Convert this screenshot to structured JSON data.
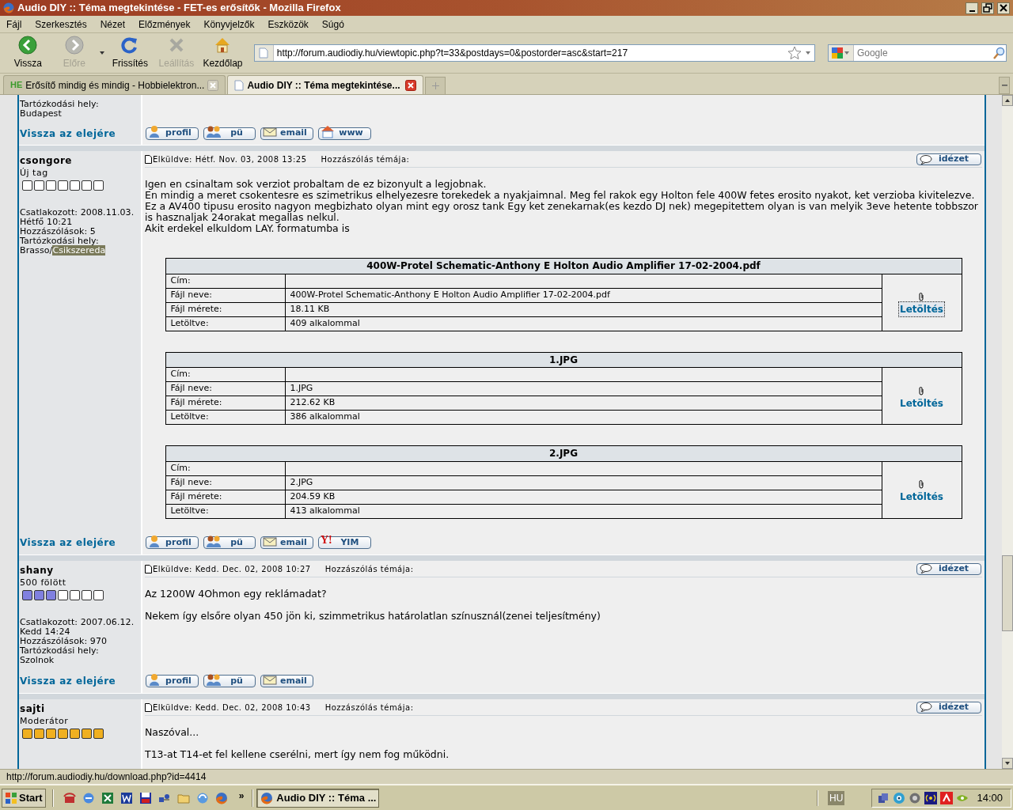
{
  "window": {
    "title": "Audio DIY :: Téma megtekintése - FET-es erősítők - Mozilla Firefox"
  },
  "menu": [
    {
      "label": "Fájl"
    },
    {
      "label": "Szerkesztés"
    },
    {
      "label": "Nézet"
    },
    {
      "label": "Előzmények"
    },
    {
      "label": "Könyvjelzők"
    },
    {
      "label": "Eszközök"
    },
    {
      "label": "Súgó"
    }
  ],
  "toolbar": {
    "buttons": [
      {
        "kind": "back",
        "label": "Vissza",
        "disabled": false
      },
      {
        "kind": "forward",
        "label": "Előre",
        "disabled": true
      },
      {
        "kind": "reload",
        "label": "Frissítés",
        "disabled": false
      },
      {
        "kind": "stop",
        "label": "Leállítás",
        "disabled": true
      },
      {
        "kind": "home",
        "label": "Kezdőlap",
        "disabled": false
      }
    ],
    "url": "http://forum.audiodiy.hu/viewtopic.php?t=33&postdays=0&postorder=asc&start=217",
    "search_placeholder": "Google"
  },
  "tabs": [
    {
      "label": "Erősítő mindig és mindig - Hobbielektron...",
      "favicon_text": "HE",
      "selected": false
    },
    {
      "label": "Audio DIY :: Téma megtekintése...",
      "selected": true
    }
  ],
  "top_post": {
    "details": [
      "Tartózkodási hely:",
      "Budapest"
    ],
    "back_link": "Vissza az elejére",
    "buttons": [
      {
        "kind": "profile",
        "label": "profil"
      },
      {
        "kind": "pm",
        "label": "pü"
      },
      {
        "kind": "email",
        "label": "email"
      },
      {
        "kind": "www",
        "label": "www"
      }
    ]
  },
  "posts": [
    {
      "author": "csongore",
      "rank_title": "Új tag",
      "rank": {
        "stars": 0
      },
      "details": [
        "Csatlakozott: 2008.11.03.",
        "Hétfő 10:21",
        "Hozzászólások: 5",
        "Tartózkodási hely:"
      ],
      "location_parts": [
        {
          "text": "Brasso/",
          "highlighted": false
        },
        {
          "text": "Csikszereda",
          "highlighted": true
        }
      ],
      "posted": "Elküldve: Hétf. Nov. 03, 2008 13:25",
      "subject_label": "Hozzászólás témája:",
      "quote_button": "idézet",
      "paragraphs": [
        [
          "Igen en csinaltam sok verziot probaltam de ez bizonyult a legjobnak.",
          "En mindig a meret csokentesre es szimetrikus elhelyezesre torekedek a nyakjaimnal. Meg fel rakok egy Holton fele 400W fetes erosito nyakot, ket verzioba kivitelezve.",
          "Ez a AV400 tipusu erosito nagyon megbizhato olyan mint egy orosz tank Egy ket zenekarnak(es kezdo DJ nek) megepitettem olyan is van melyik 3eve hetente tobbszor is hasznaljak 24orakat megallas nelkul.",
          "Akit erdekel elkuldom LAY. formatumba is"
        ]
      ],
      "attachments": [
        {
          "title": "400W-Protel Schematic-Anthony E Holton Audio Amplifier 17-02-2004.pdf",
          "rows": [
            {
              "label": "Cím:"
            },
            {
              "label": "Fájl neve:",
              "value": "400W-Protel Schematic-Anthony E Holton Audio Amplifier 17-02-2004.pdf"
            },
            {
              "label": "Fájl mérete:",
              "value": "18.11 KB"
            },
            {
              "label": "Letöltve:",
              "value": "409 alkalommal"
            }
          ],
          "download": "Letöltés",
          "focused": true
        },
        {
          "title": "1.JPG",
          "rows": [
            {
              "label": "Cím:"
            },
            {
              "label": "Fájl neve:",
              "value": "1.JPG"
            },
            {
              "label": "Fájl mérete:",
              "value": "212.62 KB"
            },
            {
              "label": "Letöltve:",
              "value": "386 alkalommal"
            }
          ],
          "download": "Letöltés",
          "focused": false
        },
        {
          "title": "2.JPG",
          "rows": [
            {
              "label": "Cím:"
            },
            {
              "label": "Fájl neve:",
              "value": "2.JPG"
            },
            {
              "label": "Fájl mérete:",
              "value": "204.59 KB"
            },
            {
              "label": "Letöltve:",
              "value": "413 alkalommal"
            }
          ],
          "download": "Letöltés",
          "focused": false
        }
      ],
      "back_link": "Vissza az elejére",
      "buttons": [
        {
          "kind": "profile",
          "label": "profil"
        },
        {
          "kind": "pm",
          "label": "pü"
        },
        {
          "kind": "email",
          "label": "email"
        },
        {
          "kind": "yim",
          "label": "YIM",
          "logo": "Y!"
        }
      ]
    },
    {
      "author": "shany",
      "rank_title": "500 fölött",
      "rank": {
        "stars": 3,
        "color": "#8080e0"
      },
      "details": [
        "Csatlakozott: 2007.06.12.",
        "Kedd 14:24",
        "Hozzászólások: 970",
        "Tartózkodási hely:"
      ],
      "location_parts": [
        {
          "text": "Szolnok",
          "highlighted": false
        }
      ],
      "posted": "Elküldve: Kedd. Dec. 02, 2008 10:27",
      "subject_label": "Hozzászólás témája:",
      "quote_button": "idézet",
      "paragraphs": [
        [
          "Az 1200W 4Ohmon egy reklámadat?"
        ],
        [
          "Nekem így elsőre olyan 450 jön ki, szimmetrikus határolatlan színusznál(zenei teljesítmény)"
        ]
      ],
      "back_link": "Vissza az elejére",
      "buttons": [
        {
          "kind": "profile",
          "label": "profil"
        },
        {
          "kind": "pm",
          "label": "pü"
        },
        {
          "kind": "email",
          "label": "email"
        }
      ]
    },
    {
      "author": "sajti",
      "rank_title": "Moderátor",
      "rank": {
        "stars": 7,
        "color": "#f0b020"
      },
      "posted": "Elküldve: Kedd. Dec. 02, 2008 10:43",
      "subject_label": "Hozzászólás témája:",
      "quote_button": "idézet",
      "paragraphs": [
        [
          "Naszóval..."
        ],
        [
          "T13-at T14-et fel kellene cserélni, mert így nem fog működni."
        ]
      ]
    }
  ],
  "status_bar": {
    "text": "http://forum.audiodiy.hu/download.php?id=4414"
  },
  "taskbar": {
    "start": "Start",
    "more": "»",
    "windows": [
      {
        "label": "Audio DIY :: Téma ...",
        "selected": true
      }
    ],
    "language": "HU",
    "clock": "14:00"
  }
}
